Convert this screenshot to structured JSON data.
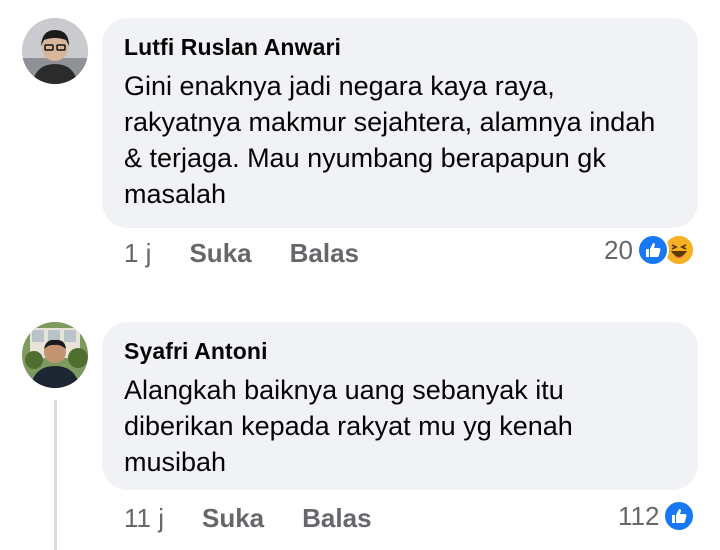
{
  "comments": [
    {
      "author": "Lutfi Ruslan Anwari",
      "text": "Gini enaknya jadi negara kaya raya, rakyatnya makmur sejahtera, alamnya indah & terjaga. Mau nyumbang berapapun gk masalah",
      "time": "1 j",
      "like_label": "Suka",
      "reply_label": "Balas",
      "reaction_count": "20",
      "reactions": [
        "like-icon",
        "haha-icon"
      ]
    },
    {
      "author": "Syafri Antoni",
      "text": "Alangkah baiknya uang sebanyak itu diberikan kepada rakyat mu yg kenah musibah",
      "time": "11 j",
      "like_label": "Suka",
      "reply_label": "Balas",
      "reaction_count": "112",
      "reactions": [
        "like-icon"
      ]
    }
  ],
  "colors": {
    "bubble": "#f0f2f5",
    "meta_text": "#65676b",
    "like_blue": "#1877f2",
    "haha_yellow": "#f7b125"
  }
}
